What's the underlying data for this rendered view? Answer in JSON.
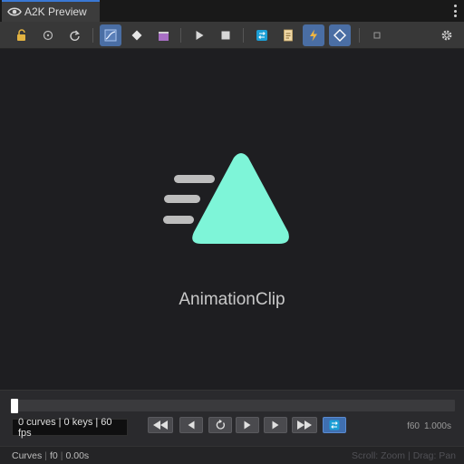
{
  "window": {
    "tab_title": "A2K Preview"
  },
  "toolbar": {
    "buttons": [
      {
        "name": "lock",
        "icon": "lock-icon",
        "active": false
      },
      {
        "name": "target",
        "icon": "target-icon",
        "active": false
      },
      {
        "name": "reset",
        "icon": "rotate-icon",
        "active": false
      },
      {
        "name": "curve-view",
        "icon": "curve-graph-icon",
        "active": true
      },
      {
        "name": "keyframe",
        "icon": "diamond-icon",
        "active": false
      },
      {
        "name": "clip",
        "icon": "clapperboard-icon",
        "active": false
      },
      {
        "name": "play",
        "icon": "play-icon",
        "active": false
      },
      {
        "name": "stop",
        "icon": "stop-icon",
        "active": false
      },
      {
        "name": "loop",
        "icon": "loop-icon",
        "active": false
      },
      {
        "name": "notes",
        "icon": "document-icon",
        "active": false
      },
      {
        "name": "events",
        "icon": "lightning-icon",
        "active": true
      },
      {
        "name": "keys",
        "icon": "diamond-outline-icon",
        "active": true
      },
      {
        "name": "frame",
        "icon": "small-square-icon",
        "active": false
      },
      {
        "name": "settings",
        "icon": "gear-icon",
        "active": false
      }
    ]
  },
  "viewport": {
    "clip_name": "AnimationClip",
    "accent_color": "#7ef5d8"
  },
  "transport": {
    "progress": 0.0,
    "info": "0 curves | 0 keys | 60 fps",
    "frame": "f60",
    "time": "1.000s",
    "loop_active": true
  },
  "status": {
    "curves": "Curves",
    "frame": "f0",
    "time": "0.00s",
    "hint_scroll": "Scroll: Zoom",
    "hint_drag": "Drag: Pan"
  }
}
